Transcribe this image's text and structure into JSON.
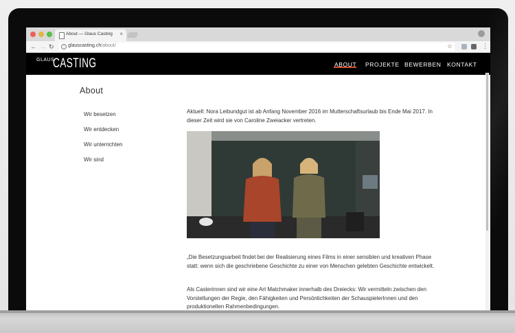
{
  "browser": {
    "tab_title": "About — Glaus Casting",
    "tab_close": "×",
    "url_domain": "glauscasting.ch",
    "url_path": "/about/",
    "icons": [
      "back-arrow-icon",
      "forward-arrow-icon",
      "reload-icon",
      "info-icon",
      "star-icon",
      "menu-icon"
    ]
  },
  "site": {
    "logo_small": "GLAUS",
    "logo_big": "CASTING",
    "nav": [
      "ABOUT",
      "PROJEKTE",
      "BEWERBEN",
      "KONTAKT"
    ],
    "active_nav": "ABOUT",
    "accent_color": "#d5512d"
  },
  "page": {
    "title": "About",
    "sidebar": [
      "Wir besetzen",
      "Wir entdecken",
      "Wir unterrichten",
      "Wir sind"
    ],
    "intro": "Aktuell: Nora Leibundgut ist ab Anfang November 2016 im Mutterschaftsurlaub bis Ende Mai 2017. In dieser Zeit wird sie von Caroline Zweiacker vertreten.",
    "paragraph1": "„Die Besetzungsarbeit findet bei der Realisierung eines Films in einer sensiblen und kreativen Phase statt: wenn sich die geschriebene Geschichte zu einer von Menschen gelebten Geschichte entwickelt.",
    "paragraph2": "Als Casterinnen sind wir eine Art Matchmaker innerhalb des Dreiecks: Wir vermitteln zwischen den Vorstellungen der Regie, den Fähigkeiten und Persönlichkeiten der SchauspielerInnen und den produktionellen Rahmenbedingungen."
  }
}
